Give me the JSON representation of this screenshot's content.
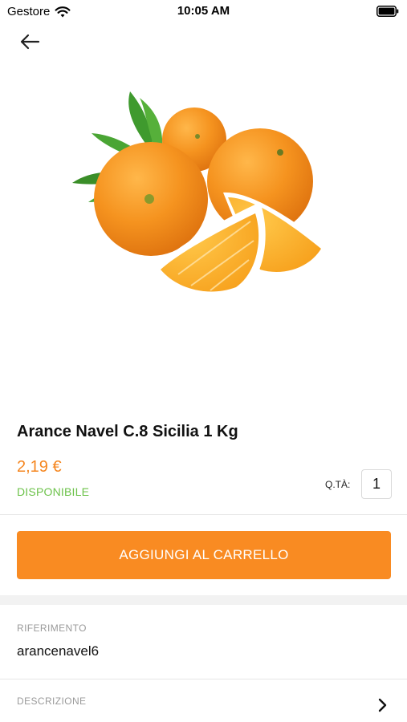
{
  "status_bar": {
    "carrier": "Gestore",
    "time": "10:05 AM",
    "icons": [
      "wifi-icon",
      "battery-icon"
    ]
  },
  "nav": {
    "back_icon": "arrow-left-icon"
  },
  "product": {
    "image_icon": "oranges-image",
    "title": "Arance Navel C.8 Sicilia 1 Kg",
    "price": "2,19 €",
    "availability": "DISPONIBILE",
    "quantity_label": "Q.TÀ:",
    "quantity_value": "1"
  },
  "actions": {
    "add_to_cart": "AGGIUNGI AL CARRELLO"
  },
  "details": {
    "reference_label": "RIFERIMENTO",
    "reference_value": "arancenavel6",
    "description_label": "DESCRIZIONE",
    "description_icon": "chevron-right-icon"
  },
  "colors": {
    "accent": "#f98b22",
    "price": "#f5861f",
    "available": "#6cc24a"
  }
}
